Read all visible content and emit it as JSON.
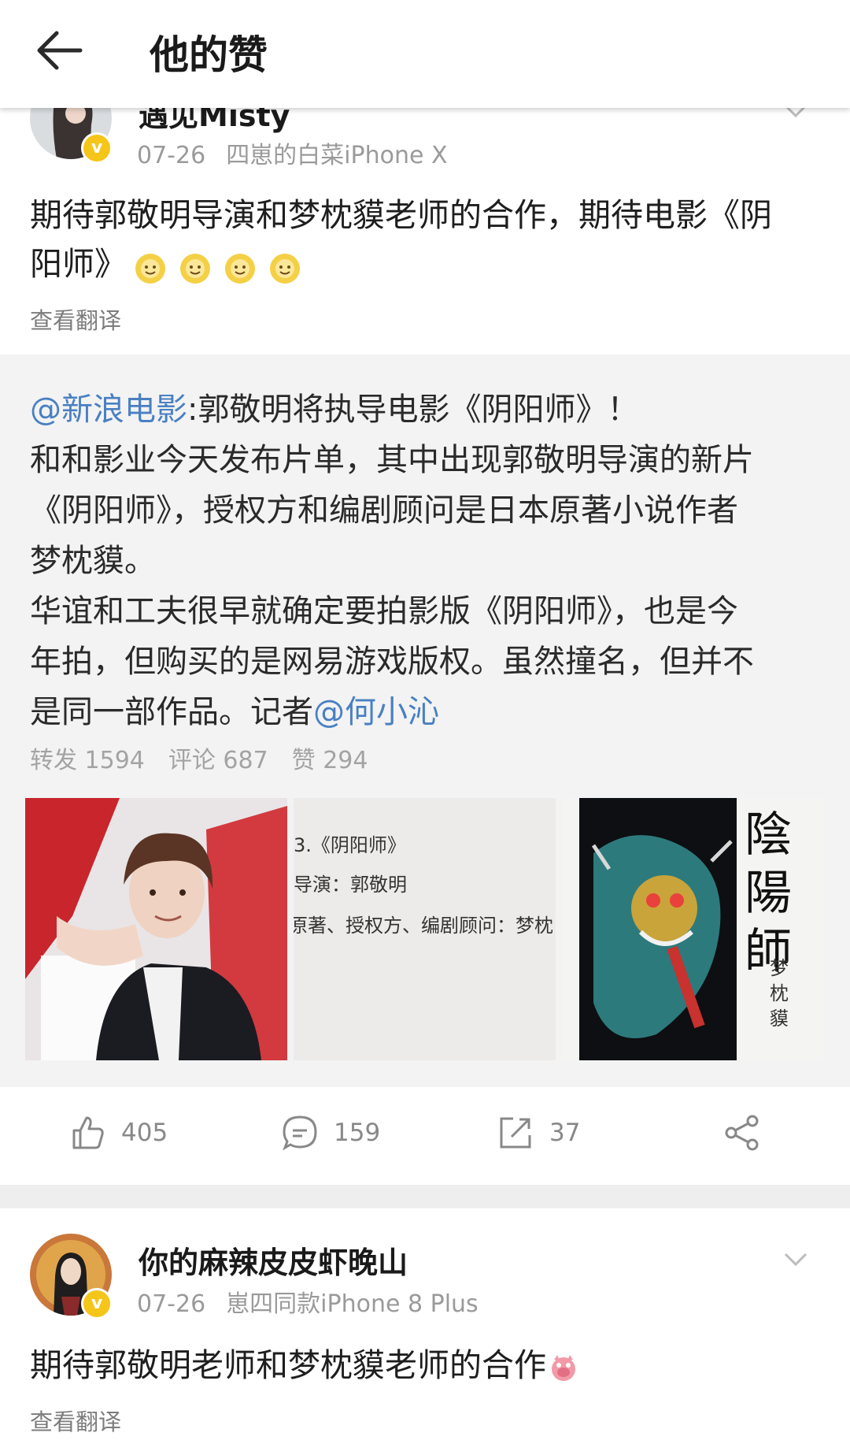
{
  "header": {
    "title": "他的赞"
  },
  "post1": {
    "username": "遇见Misty",
    "date": "07-26",
    "source": "四崽的白菜iPhone X",
    "text_line1": "期待郭敬明导演和梦枕貘老师的合作，期待电影《阴",
    "text_line2": "阳师》",
    "translate": "查看翻译"
  },
  "repost": {
    "mention": "@新浪电影",
    "line1": ":郭敬明将执导电影《阴阳师》！",
    "line2": "和和影业今天发布片单，其中出现郭敬明导演的新片",
    "line3": "《阴阳师》，授权方和编剧顾问是日本原著小说作者",
    "line4": "梦枕貘。",
    "line5": "华谊和工夫很早就确定要拍影版《阴阳师》，也是今",
    "line6": "年拍，但购买的是网易游戏版权。虽然撞名，但并不",
    "line7_prefix": "是同一部作品。记者",
    "line7_mention": "@何小沁",
    "stats": {
      "forward": "转发 1594",
      "comment": "评论 687",
      "like": "赞 294"
    },
    "images": {
      "img2_line1": "3.《阴阳师》",
      "img2_line2": "导演：郭敬明",
      "img2_line3": "原著、授权方、编剧顾问：梦枕",
      "img3_title": "陰陽師",
      "img3_author": "梦枕貘"
    }
  },
  "actions": {
    "like_count": "405",
    "comment_count": "159",
    "repost_count": "37"
  },
  "post2": {
    "username": "你的麻辣皮皮虾晚山",
    "date": "07-26",
    "source": "崽四同款iPhone 8 Plus",
    "text": "期待郭敬明老师和梦枕貘老师的合作",
    "translate": "查看翻译"
  }
}
